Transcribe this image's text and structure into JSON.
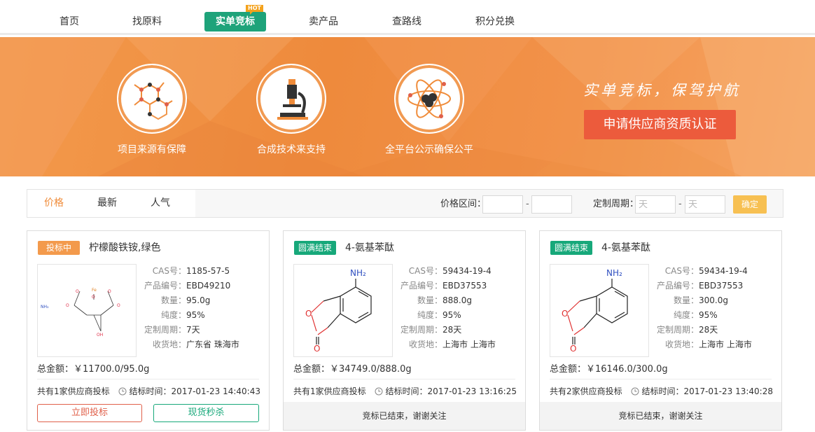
{
  "nav": {
    "items": [
      {
        "label": "首页"
      },
      {
        "label": "找原料"
      },
      {
        "label": "实单竞标",
        "badge": "HOT"
      },
      {
        "label": "卖产品"
      },
      {
        "label": "查路线"
      },
      {
        "label": "积分兑换"
      }
    ],
    "active_index": 2
  },
  "banner": {
    "features": [
      {
        "label": "项目来源有保障",
        "icon": "molecule-structure-icon"
      },
      {
        "label": "合成技术来支持",
        "icon": "microscope-icon"
      },
      {
        "label": "全平台公示确保公平",
        "icon": "atom-icon"
      }
    ],
    "slogan": "实单竞标，保驾护航",
    "apply_label": "申请供应商资质认证"
  },
  "filter": {
    "tabs": [
      {
        "label": "价格"
      },
      {
        "label": "最新"
      },
      {
        "label": "人气"
      }
    ],
    "active_tab": 0,
    "price_label": "价格区间：",
    "period_label": "定制周期：",
    "period_placeholder_min": "天",
    "period_placeholder_max": "天",
    "dash": "-",
    "confirm_label": "确定"
  },
  "spec_keys": {
    "cas": "CAS号：",
    "code": "产品编号：",
    "qty": "数量：",
    "purity": "纯度：",
    "period": "定制周期：",
    "dest": "收货地："
  },
  "cards": [
    {
      "status": "投标中",
      "name": "柠檬酸铁铵,绿色",
      "cas": "1185-57-5",
      "code": "EBD49210",
      "qty": "95.0g",
      "purity": "95%",
      "period": "7天",
      "dest": "广东省 珠海市",
      "total": "总金额：￥11700.0/95.0g",
      "suppliers": "共有1家供应商投标",
      "end_time": "结标时间：2017-01-23 14:40:43",
      "bid_label": "立即投标",
      "spot_label": "现货秒杀"
    },
    {
      "status": "圆满结束",
      "name": "4-氨基苯酞",
      "cas": "59434-19-4",
      "code": "EBD37553",
      "qty": "888.0g",
      "purity": "95%",
      "period": "28天",
      "dest": "上海市 上海市",
      "total": "总金额：￥34749.0/888.0g",
      "suppliers": "共有1家供应商投标",
      "end_time": "结标时间：2017-01-23 13:16:25",
      "ended_label": "竞标已结束，谢谢关注"
    },
    {
      "status": "圆满结束",
      "name": "4-氨基苯酞",
      "cas": "59434-19-4",
      "code": "EBD37553",
      "qty": "300.0g",
      "purity": "95%",
      "period": "28天",
      "dest": "上海市 上海市",
      "total": "总金额：￥16146.0/300.0g",
      "suppliers": "共有2家供应商投标",
      "end_time": "结标时间：2017-01-23 13:40:28",
      "ended_label": "竞标已结束，谢谢关注"
    }
  ],
  "structure_labels": {
    "nh2": "NH₂",
    "nh3": "NH₃",
    "fe": "Fe",
    "oh": "OH",
    "o": "O"
  },
  "colors": {
    "brand_green": "#1ea37a",
    "banner_orange": "#ef8e40",
    "apply_red": "#ec5b3c",
    "bidding_orange": "#f39a4c",
    "confirm_yellow": "#f7c052"
  }
}
